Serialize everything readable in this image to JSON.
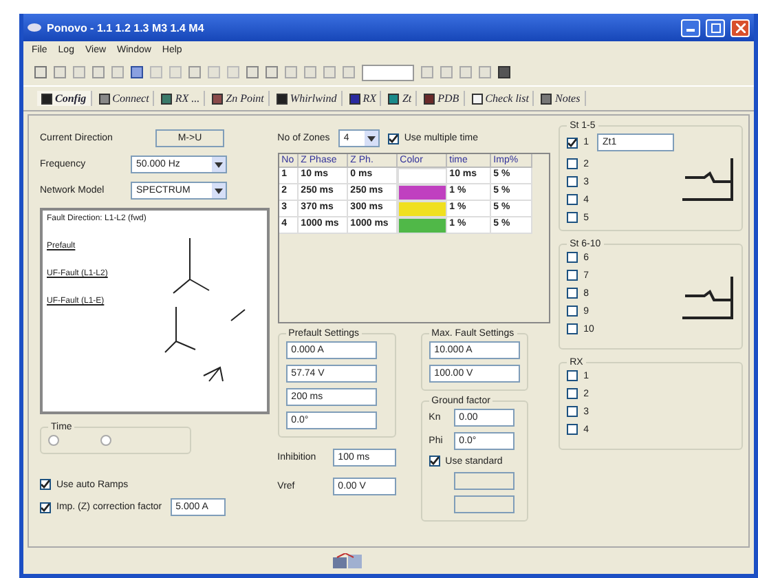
{
  "window": {
    "title": "Ponovo - 1.1  1.2  1.3 M3  1.4 M4"
  },
  "menu": [
    "File",
    "Log",
    "View",
    "Window",
    "Help"
  ],
  "tabs": [
    {
      "label": "Config",
      "selected": true
    },
    {
      "label": "Connect",
      "selected": false
    },
    {
      "label": "RX ...",
      "selected": false
    },
    {
      "label": "Zn Point",
      "selected": false
    },
    {
      "label": "Whirlwind",
      "selected": false
    },
    {
      "label": "RX",
      "selected": false
    },
    {
      "label": "Zt",
      "selected": false
    },
    {
      "label": "PDB",
      "selected": false
    },
    {
      "label": "Check list",
      "selected": false
    },
    {
      "label": "Notes",
      "selected": false
    }
  ],
  "config": {
    "current_direction": {
      "label": "Current Direction",
      "value": "M->U"
    },
    "zones": {
      "label": "No of Zones",
      "value": "4"
    },
    "multiple_time": {
      "label": "Use multiple time",
      "checked": true
    },
    "frequency": {
      "label": "Frequency",
      "value": "50.000 Hz"
    },
    "network_model": {
      "label": "Network Model",
      "value": "SPECTRUM"
    },
    "diagram": {
      "labels": [
        "Fault Direction: L1-L2 (fwd)",
        "Prefault",
        "UF-Fault (L1-L2)",
        "UF-Fault (L1-E)"
      ]
    },
    "time_group": {
      "label": "Time",
      "options": [
        {
          "selected": false,
          "disabled": true
        },
        {
          "selected": false,
          "disabled": true
        }
      ]
    },
    "auto_ramps": {
      "label": "Use auto Ramps",
      "checked": true
    },
    "imp_correction": {
      "label": "Imp. (Z) correction factor",
      "checked": true,
      "value": "5.000 A"
    },
    "zone_table": {
      "columns": [
        "No",
        "Z Phase",
        "Z Ph.",
        "Color",
        "time",
        "Imp%"
      ],
      "rows": [
        {
          "cells": [
            "1",
            "10 ms",
            "0 ms",
            "",
            "10 ms",
            "5 %"
          ],
          "color": "#ffffff"
        },
        {
          "cells": [
            "2",
            "250 ms",
            "250 ms",
            "",
            "1 %",
            "5 %"
          ],
          "color": "#c040c0"
        },
        {
          "cells": [
            "3",
            "370 ms",
            "300 ms",
            "",
            "1 %",
            "5 %"
          ],
          "color": "#f0e020"
        },
        {
          "cells": [
            "4",
            "1000 ms",
            "1000 ms",
            "",
            "1 %",
            "5 %"
          ],
          "color": "#50b848"
        }
      ]
    },
    "prefault": {
      "title": "Prefault Settings",
      "values": [
        "0.000 A",
        "57.74 V",
        "200 ms",
        "0.0°"
      ]
    },
    "max_fault": {
      "title": "Max. Fault Settings",
      "values": [
        "10.000 A",
        "100.00 V"
      ]
    },
    "ground_factor": {
      "title": "Ground factor",
      "fields": [
        {
          "label": "Kn",
          "value": "0.00"
        },
        {
          "label": "Phi",
          "value": "0.0°"
        }
      ],
      "use_standard": {
        "label": "Use standard",
        "checked": true
      },
      "extra_fields": [
        {
          "disabled": true
        },
        {
          "disabled": true
        }
      ]
    },
    "inhibit": {
      "label": "Inhibition",
      "value": "100 ms"
    },
    "vref": {
      "label": "Vref",
      "value": "0.00 V"
    },
    "zone_groups": [
      {
        "title": "St 1-5",
        "graph": true,
        "items": [
          {
            "label": "1",
            "checked": true,
            "value": "Zt1"
          },
          {
            "label": "2",
            "checked": false
          },
          {
            "label": "3",
            "checked": false
          },
          {
            "label": "4",
            "checked": false
          },
          {
            "label": "5",
            "checked": false
          }
        ]
      },
      {
        "title": "St 6-10",
        "graph": true,
        "items": [
          {
            "label": "6",
            "checked": false
          },
          {
            "label": "7",
            "checked": false
          },
          {
            "label": "8",
            "checked": false
          },
          {
            "label": "9",
            "checked": false
          },
          {
            "label": "10",
            "checked": false
          }
        ]
      },
      {
        "title": "RX",
        "graph": false,
        "items": [
          {
            "label": "1",
            "checked": false
          },
          {
            "label": "2",
            "checked": false
          },
          {
            "label": "3",
            "checked": false
          },
          {
            "label": "4",
            "checked": false
          }
        ]
      }
    ]
  }
}
